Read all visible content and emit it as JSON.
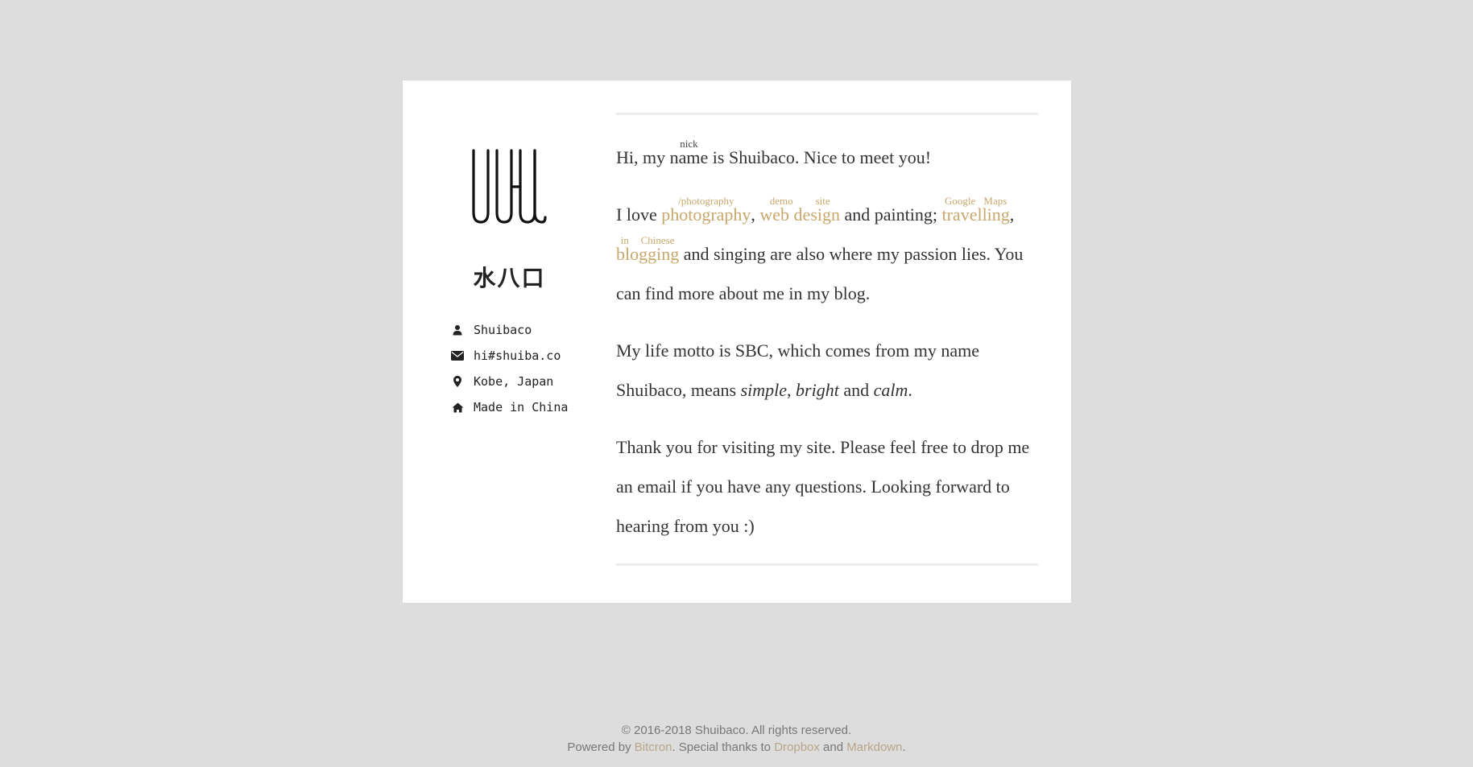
{
  "profile": {
    "cn_name": "水八口",
    "info": [
      {
        "icon": "user-icon",
        "text": "Shuibaco"
      },
      {
        "icon": "envelope-icon",
        "text": "hi#shuiba.co"
      },
      {
        "icon": "map-marker-icon",
        "text": "Kobe, Japan"
      },
      {
        "icon": "home-icon",
        "text": "Made in China"
      }
    ]
  },
  "content": {
    "p1": {
      "before": "Hi, my ",
      "ruby_base": "name",
      "ruby_note": "nick",
      "after": " is Shuibaco. Nice to meet you!"
    },
    "p2": {
      "intro": "I love ",
      "photography": {
        "text": "photography",
        "note": "/photography"
      },
      "sep1": ", ",
      "webdesign": {
        "text": "web design",
        "note": "demo site"
      },
      "mid": " and painting; ",
      "travelling": {
        "text": "travelling",
        "note": "Google Maps"
      },
      "sep2": ", ",
      "blogging": {
        "text": "blogging",
        "note": "in Chinese"
      },
      "end": " and singing are also where my passion lies. You can find more about me in my blog."
    },
    "p3": {
      "start": "My life motto is SBC, which comes from my name Shuibaco, means ",
      "simple": "simple",
      "sep": ", ",
      "bright": "bright",
      "and": " and ",
      "calm": "calm",
      "end": "."
    },
    "p4": "Thank you for visiting my site. Please feel free to drop me an email if you have any questions. Looking forward to hearing from you :)"
  },
  "footer": {
    "copyright": "© 2016-2018 Shuibaco. All rights reserved.",
    "powered_prefix": "Powered by ",
    "bitcron": "Bitcron",
    "special": ". Special thanks to ",
    "dropbox": "Dropbox",
    "and": " and ",
    "markdown": "Markdown",
    "end": "."
  },
  "colors": {
    "background": "#dddddd",
    "card": "#ffffff",
    "link_gold": "#c8a86b",
    "text": "#333333"
  }
}
